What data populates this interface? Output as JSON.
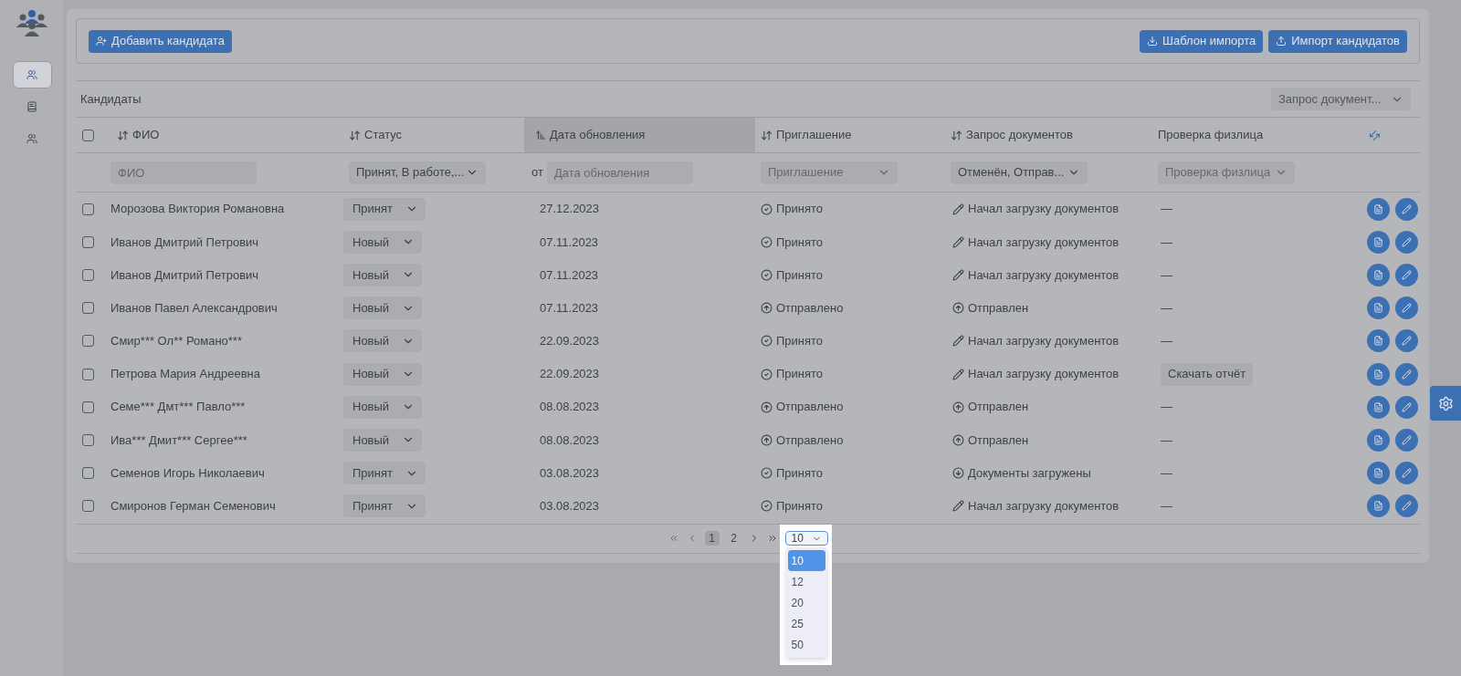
{
  "sidebar": {
    "items": [
      {
        "kind": "people",
        "selected": true
      },
      {
        "kind": "book",
        "selected": false
      },
      {
        "kind": "people",
        "selected": false
      }
    ]
  },
  "toolbar": {
    "add_button": "Добавить кандидата",
    "template_button": "Шаблон импорта",
    "import_button": "Импорт кандидатов"
  },
  "section": {
    "title": "Кандидаты",
    "column_select": "Запрос документ..."
  },
  "table": {
    "all_checked": false,
    "columns": [
      {
        "label": "ФИО",
        "sortable": true,
        "sorted": false
      },
      {
        "label": "Статус",
        "sortable": true,
        "sorted": false
      },
      {
        "label": "Дата обновления",
        "sortable": true,
        "sorted": true
      },
      {
        "label": "Приглашение",
        "sortable": true,
        "sorted": false
      },
      {
        "label": "Запрос документов",
        "sortable": true,
        "sorted": false
      },
      {
        "label": "Проверка физлица",
        "sortable": false,
        "sorted": false
      }
    ],
    "filters": [
      {
        "kind": "input",
        "placeholder": "ФИО"
      },
      {
        "kind": "select",
        "value": "Принят, В работе,..."
      },
      {
        "kind": "date",
        "prefix": "от",
        "placeholder": "Дата обновления"
      },
      {
        "kind": "select",
        "placeholder": "Приглашение"
      },
      {
        "kind": "select",
        "value": "Отменён, Отправ..."
      },
      {
        "kind": "select",
        "placeholder": "Проверка физлица"
      }
    ],
    "rows": [
      {
        "checked": false,
        "name": "Морозова Виктория Романовна",
        "status": "Принят",
        "date": "27.12.2023",
        "invitation": {
          "kind": "accepted",
          "text": "Принято"
        },
        "documents": {
          "kind": "started",
          "text": "Начал загрузку документов"
        },
        "check": {
          "kind": "dash",
          "text": "—"
        }
      },
      {
        "checked": false,
        "name": "Иванов Дмитрий Петрович",
        "status": "Новый",
        "date": "07.11.2023",
        "invitation": {
          "kind": "accepted",
          "text": "Принято"
        },
        "documents": {
          "kind": "started",
          "text": "Начал загрузку документов"
        },
        "check": {
          "kind": "dash",
          "text": "—"
        }
      },
      {
        "checked": false,
        "name": "Иванов Дмитрий Петрович",
        "status": "Новый",
        "date": "07.11.2023",
        "invitation": {
          "kind": "accepted",
          "text": "Принято"
        },
        "documents": {
          "kind": "started",
          "text": "Начал загрузку документов"
        },
        "check": {
          "kind": "dash",
          "text": "—"
        }
      },
      {
        "checked": false,
        "name": "Иванов Павел Александрович",
        "status": "Новый",
        "date": "07.11.2023",
        "invitation": {
          "kind": "sent",
          "text": "Отправлено"
        },
        "documents": {
          "kind": "sent",
          "text": "Отправлен"
        },
        "check": {
          "kind": "dash",
          "text": "—"
        }
      },
      {
        "checked": false,
        "name": "Смир*** Ол** Романо***",
        "status": "Новый",
        "date": "22.09.2023",
        "invitation": {
          "kind": "accepted",
          "text": "Принято"
        },
        "documents": {
          "kind": "started",
          "text": "Начал загрузку документов"
        },
        "check": {
          "kind": "dash",
          "text": "—"
        }
      },
      {
        "checked": false,
        "name": "Петрова Мария Андреевна",
        "status": "Новый",
        "date": "22.09.2023",
        "invitation": {
          "kind": "accepted",
          "text": "Принято"
        },
        "documents": {
          "kind": "started",
          "text": "Начал загрузку документов"
        },
        "check": {
          "kind": "button",
          "text": "Скачать отчёт"
        }
      },
      {
        "checked": false,
        "name": "Семе*** Дмт*** Павло***",
        "status": "Новый",
        "date": "08.08.2023",
        "invitation": {
          "kind": "sent",
          "text": "Отправлено"
        },
        "documents": {
          "kind": "sent",
          "text": "Отправлен"
        },
        "check": {
          "kind": "dash",
          "text": "—"
        }
      },
      {
        "checked": false,
        "name": "Ива*** Дмит*** Сергее***",
        "status": "Новый",
        "date": "08.08.2023",
        "invitation": {
          "kind": "sent",
          "text": "Отправлено"
        },
        "documents": {
          "kind": "sent",
          "text": "Отправлен"
        },
        "check": {
          "kind": "dash",
          "text": "—"
        }
      },
      {
        "checked": false,
        "name": "Семенов Игорь Николаевич",
        "status": "Принят",
        "date": "03.08.2023",
        "invitation": {
          "kind": "accepted",
          "text": "Принято"
        },
        "documents": {
          "kind": "loaded",
          "text": "Документы загружены"
        },
        "check": {
          "kind": "dash",
          "text": "—"
        }
      },
      {
        "checked": false,
        "name": "Смиронов Герман Семенович",
        "status": "Принят",
        "date": "03.08.2023",
        "invitation": {
          "kind": "accepted",
          "text": "Принято"
        },
        "documents": {
          "kind": "started",
          "text": "Начал загрузку документов"
        },
        "check": {
          "kind": "dash",
          "text": "—"
        }
      }
    ]
  },
  "pagination": {
    "pages": [
      {
        "label": "1",
        "selected": true
      },
      {
        "label": "2",
        "selected": false
      }
    ],
    "page_size": {
      "value": "10",
      "expanded": true,
      "options": [
        {
          "label": "10",
          "selected": true
        },
        {
          "label": "12",
          "selected": false
        },
        {
          "label": "20",
          "selected": false
        },
        {
          "label": "25",
          "selected": false
        },
        {
          "label": "50",
          "selected": false
        }
      ]
    }
  }
}
